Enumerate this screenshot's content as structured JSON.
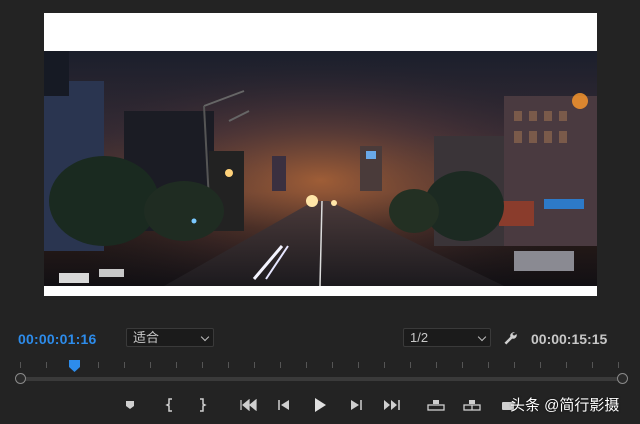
{
  "monitor": {
    "current_time": "00:00:01:16",
    "zoom_option": "适合",
    "resolution_option": "1/2",
    "duration": "00:00:15:15",
    "playhead_position_fraction": 0.1,
    "accent_color": "#2d8ceb"
  },
  "icons": {
    "settings": "wrench-icon",
    "add_marker": "marker-icon",
    "mark_in": "mark-in-icon",
    "mark_out": "mark-out-icon",
    "go_to_in": "go-to-in-icon",
    "step_back": "step-back-icon",
    "play": "play-icon",
    "step_forward": "step-forward-icon",
    "go_to_out": "go-to-out-icon",
    "lift": "lift-icon",
    "extract": "extract-icon",
    "export_frame": "camera-icon"
  },
  "watermark": {
    "text": "头条 @简行影摄"
  }
}
